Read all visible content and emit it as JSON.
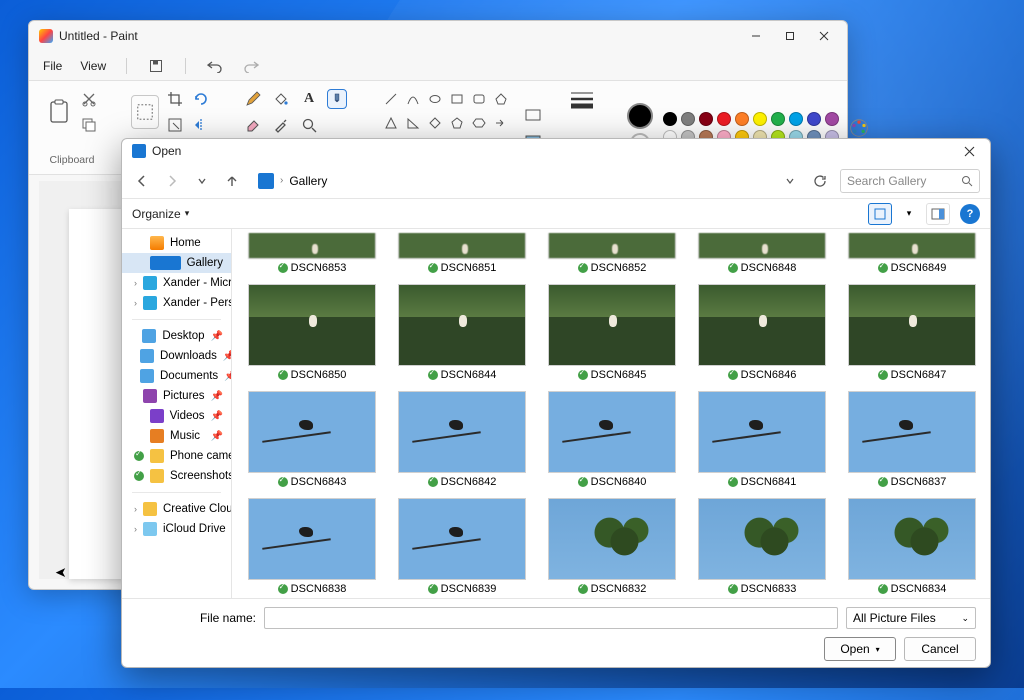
{
  "paint": {
    "title": "Untitled - Paint",
    "menu": {
      "file": "File",
      "view": "View"
    },
    "groups": {
      "clipboard": "Clipboard"
    }
  },
  "dialog": {
    "title": "Open",
    "breadcrumb": {
      "gallery": "Gallery"
    },
    "search_placeholder": "Search Gallery",
    "organize": "Organize",
    "footer": {
      "filename_label": "File name:",
      "filter": "All Picture Files",
      "open": "Open",
      "cancel": "Cancel"
    }
  },
  "sidebar": {
    "home": "Home",
    "gallery": "Gallery",
    "cloud1": "Xander - Micros…",
    "cloud2": "Xander - Person…",
    "desktop": "Desktop",
    "downloads": "Downloads",
    "documents": "Documents",
    "pictures": "Pictures",
    "videos": "Videos",
    "music": "Music",
    "phone": "Phone camer",
    "screenshots": "Screenshots",
    "ccf": "Creative Cloud F",
    "icloud": "iCloud Drive"
  },
  "thumbs": {
    "r0": [
      "DSCN6853",
      "DSCN6851",
      "DSCN6852",
      "DSCN6848",
      "DSCN6849"
    ],
    "r1": [
      "DSCN6850",
      "DSCN6844",
      "DSCN6845",
      "DSCN6846",
      "DSCN6847"
    ],
    "r2": [
      "DSCN6843",
      "DSCN6842",
      "DSCN6840",
      "DSCN6841",
      "DSCN6837"
    ],
    "r3": [
      "DSCN6838",
      "DSCN6839",
      "DSCN6832",
      "DSCN6833",
      "DSCN6834"
    ]
  },
  "colors": {
    "current": "#000000",
    "row1": [
      "#000000",
      "#7f7f7f",
      "#880015",
      "#ed1c24",
      "#ff7f27",
      "#fff200",
      "#22b14c",
      "#00a2e8",
      "#3f48cc",
      "#a349a4"
    ],
    "row2": [
      "#ffffff",
      "#c3c3c3",
      "#b97a57",
      "#ffaec9",
      "#ffc90e",
      "#efe4b0",
      "#b5e61d",
      "#99d9ea",
      "#7092be",
      "#c8bfe7"
    ]
  }
}
